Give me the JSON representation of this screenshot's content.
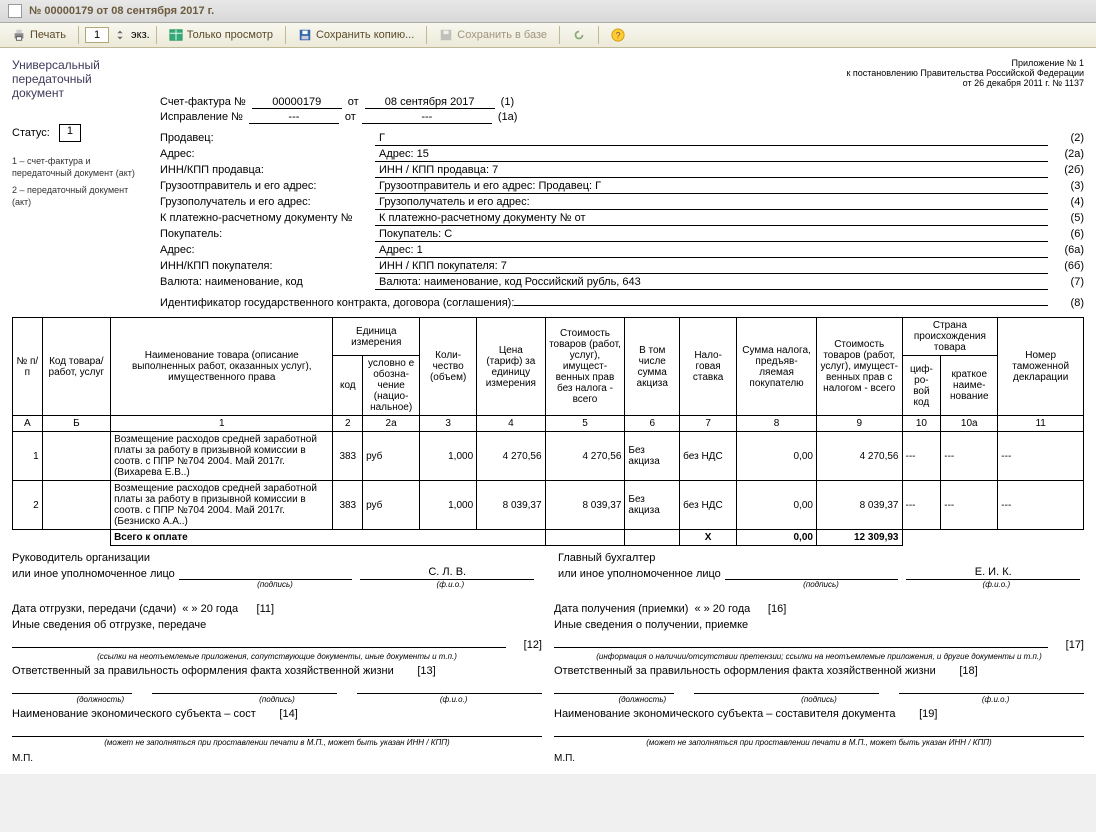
{
  "title": "№ 00000179 от 08 сентября 2017 г.",
  "toolbar": {
    "print": "Печать",
    "copies": "1",
    "ekz": "экз.",
    "view_only": "Только просмотр",
    "save_copy": "Сохранить копию...",
    "save_db": "Сохранить в базе"
  },
  "left": {
    "title1": "Универсальный",
    "title2": "передаточный",
    "title3": "документ",
    "status_label": "Статус:",
    "status_value": "1",
    "foot1": "1 – счет-фактура и передаточный документ (акт)",
    "foot2": "2 – передаточный документ (акт)"
  },
  "decree": {
    "l1": "Приложение № 1",
    "l2": "к постановлению Правительства Российской Федерации",
    "l3": "от 26 декабря 2011 г. № 1137"
  },
  "header": {
    "invoice_no_lbl": "Счет-фактура №",
    "invoice_no": "00000179",
    "ot": "от",
    "invoice_date": "08 сентября 2017",
    "revision_lbl": "Исправление №",
    "revision_no": "---",
    "revision_date": "---",
    "p1": "(1)",
    "p1a": "(1а)"
  },
  "info": {
    "seller_lbl": "Продавец:",
    "seller_val": "Г",
    "seller_n": "(2)",
    "addr_lbl": "Адрес:",
    "addr_val": "Адрес: 15",
    "addr_n": "(2а)",
    "inn_s_lbl": "ИНН/КПП продавца:",
    "inn_s_val": "ИНН / КПП продавца: 7",
    "inn_s_n": "(2б)",
    "shipper_lbl": "Грузоотправитель и его адрес:",
    "shipper_val": "Грузоотправитель и его адрес: Продавец: Г",
    "shipper_n": "(3)",
    "consignee_lbl": "Грузополучатель и его адрес:",
    "consignee_val": "Грузополучатель и его адрес:",
    "consignee_n": "(4)",
    "paydoc_lbl": "К платежно-расчетному документу №",
    "paydoc_val": "К платежно-расчетному документу №                    от",
    "paydoc_n": "(5)",
    "buyer_lbl": "Покупатель:",
    "buyer_val": "Покупатель: С",
    "buyer_n": "(6)",
    "baddr_lbl": "Адрес:",
    "baddr_val": "Адрес: 1",
    "baddr_n": "(6а)",
    "binn_lbl": "ИНН/КПП покупателя:",
    "binn_val": "ИНН / КПП покупателя: 7",
    "binn_n": "(6б)",
    "currency_lbl": "Валюта: наименование, код",
    "currency_val": "Валюта: наименование, код Российский рубль, 643",
    "currency_n": "(7)",
    "contract_lbl": "Идентификатор государственного контракта, договора (соглашения):",
    "contract_n": "(8)"
  },
  "table": {
    "h_nn": "№ п/п",
    "h_code": "Код товара/ работ, услуг",
    "h_name": "Наименование товара (описание выполненных работ, оказанных услуг), имущественного права",
    "h_unit": "Единица измерения",
    "h_unit_code": "код",
    "h_unit_name": "условно е обозна- чение (нацио- нальное)",
    "h_qty": "Коли- чество (объем)",
    "h_price": "Цена (тариф) за единицу измерения",
    "h_cost_notax": "Стоимость товаров (работ, услуг), имущест- венных прав без налога - всего",
    "h_excise": "В том числе сумма акциза",
    "h_rate": "Нало- говая ставка",
    "h_tax": "Сумма налога, предъяв- ляемая покупателю",
    "h_cost_tax": "Стоимость товаров (работ, услуг), имущест- венных прав с налогом - всего",
    "h_country": "Страна происхождения товара",
    "h_country_code": "циф- ро- вой код",
    "h_country_name": "краткое наиме- нование",
    "h_decl": "Номер таможенной декларации",
    "col_a": "А",
    "col_b": "Б",
    "col_1": "1",
    "col_2": "2",
    "col_2a": "2а",
    "col_3": "3",
    "col_4": "4",
    "col_5": "5",
    "col_6": "6",
    "col_7": "7",
    "col_8": "8",
    "col_9": "9",
    "col_10": "10",
    "col_10a": "10а",
    "col_11": "11",
    "rows": [
      {
        "n": "1",
        "code": "",
        "name": "Возмещение расходов средней заработной платы за работу в призывной комиссии в соотв. с ППР №704 2004. Май 2017г. (Вихарева Е.В..)",
        "ucode": "383",
        "uname": "руб",
        "qty": "1,000",
        "price": "4 270,56",
        "sum": "4 270,56",
        "excise": "Без акциза",
        "rate": "без НДС",
        "tax": "0,00",
        "total": "4 270,56",
        "cc": "---",
        "cn": "---",
        "decl": "---"
      },
      {
        "n": "2",
        "code": "",
        "name": "Возмещение расходов средней заработной платы за работу в призывной комиссии в соотв. с ППР №704 2004. Май 2017г. (Безниско А.А..)",
        "ucode": "383",
        "uname": "руб",
        "qty": "1,000",
        "price": "8 039,37",
        "sum": "8 039,37",
        "excise": "Без акциза",
        "rate": "без НДС",
        "tax": "0,00",
        "total": "8 039,37",
        "cc": "---",
        "cn": "---",
        "decl": "---"
      }
    ],
    "total_lbl": "Всего к оплате",
    "total_x": "Х",
    "total_tax": "0,00",
    "total_sum": "12 309,93"
  },
  "sign": {
    "l_head": "Руководитель организации",
    "l_head2": "или иное уполномоченное лицо",
    "l_fio": "С. Л. В.",
    "pod": "(подпись)",
    "fio": "(ф.и.о.)",
    "r_head": "Главный бухгалтер",
    "r_head2": "или иное уполномоченное лицо",
    "r_fio": "Е. И. К."
  },
  "bottom": {
    "l": {
      "ship_lbl": "Дата отгрузки, передачи (сдачи)",
      "ship_val": "«         »                  20     года",
      "ship_n": "[11]",
      "info_lbl": "Иные сведения об отгрузке, передаче",
      "info_tiny": "(ссылки на неотъемлемые приложения, сопутствующие документы, иные документы и т.п.)",
      "info_n": "[12]",
      "resp_lbl": "Ответственный за правильность оформления факта хозяйственной жизни",
      "resp_n": "[13]",
      "dolzh": "(должность)",
      "entity_lbl": "Наименование экономического субъекта – сост",
      "entity_n": "[14]",
      "entity_val": "",
      "mp": "М.П.",
      "mp_tiny": "(может не заполняться при проставлении печати в М.П., может быть указан ИНН / КПП)"
    },
    "r": {
      "recv_lbl": "Дата получения (приемки)",
      "recv_val": "«         »                  20     года",
      "recv_n": "[16]",
      "info_lbl": "Иные сведения о получении, приемке",
      "info_tiny": "(информация о наличии/отсутствии претензии; ссылки на неотъемлемые приложения, и другие документы и т.п.)",
      "info_n": "[17]",
      "resp_lbl": "Ответственный за правильность оформления факта хозяйственной жизни",
      "resp_n": "[18]",
      "dolzh": "(должность)",
      "entity_lbl": "Наименование экономического субъекта – составителя документа",
      "entity_n": "[19]",
      "mp": "М.П.",
      "mp_tiny": "(может не заполняться при проставлении печати в М.П., может быть указан ИНН / КПП)"
    }
  }
}
